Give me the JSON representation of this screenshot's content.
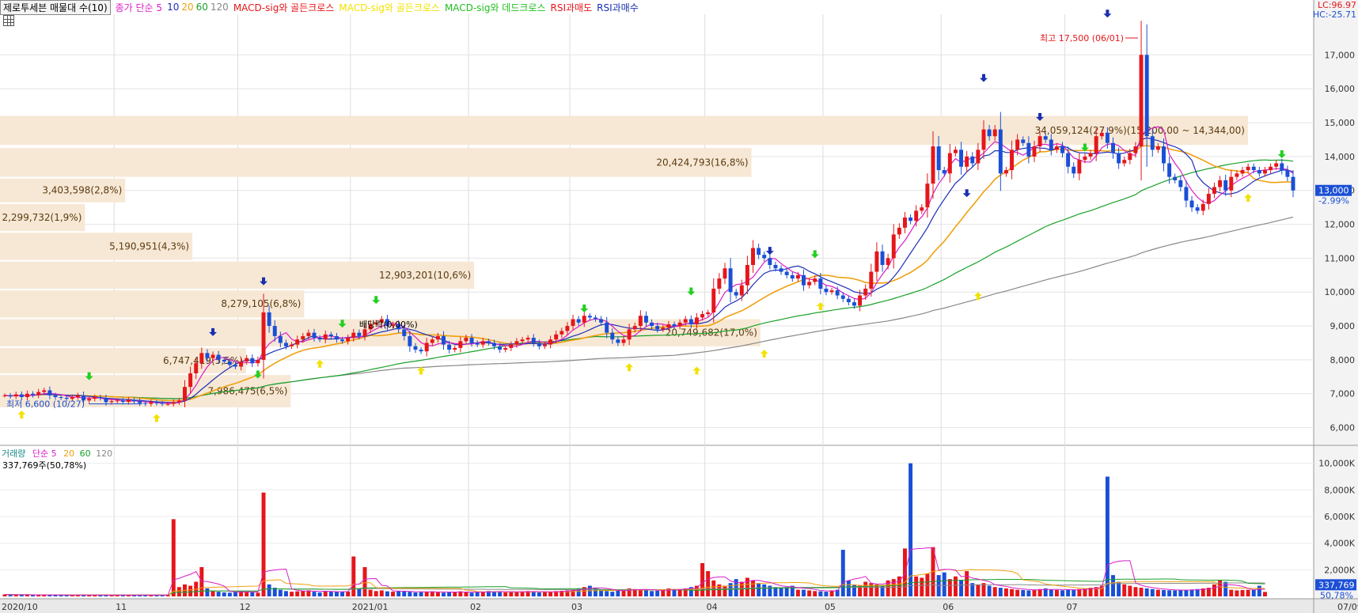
{
  "legend": {
    "title": "제로투세븐 매물대 수(10)",
    "ma_label": "종가 단순 5",
    "ma_periods": [
      "10",
      "20",
      "60",
      "120"
    ],
    "signals": [
      "MACD-sig와 골든크로스",
      "MACD-sig와 골든크로스",
      "MACD-sig와 데드크로스",
      "RSI과매도",
      "RSI과매수"
    ]
  },
  "corner": {
    "lc": "LC:96.97",
    "hc": "HC:-25.71"
  },
  "volume_legend": {
    "label": "거래량",
    "ma_label": "단순 5",
    "periods": [
      "20",
      "60",
      "120"
    ],
    "value_text": "337,769주(50,78%)"
  },
  "colors": {
    "up": "#e5161a",
    "down": "#1a4fd6",
    "ma5": "#d91ec8",
    "ma10": "#1e2fb8",
    "ma20": "#f0a010",
    "ma60": "#1aa02a",
    "ma120": "#888888",
    "profile": "#f7e8d5"
  },
  "chart_data": [
    {
      "type": "candlestick",
      "x_ticks": [
        "2020/10",
        "11",
        "12",
        "2021/01",
        "02",
        "03",
        "04",
        "05",
        "06",
        "07",
        "07/09"
      ],
      "y_ticks": [
        "6,000",
        "7,000",
        "8,000",
        "9,000",
        "10,000",
        "11,000",
        "12,000",
        "13,000",
        "14,000",
        "15,000",
        "16,000",
        "17,000"
      ],
      "ylim": [
        5500,
        18200
      ],
      "last_price": {
        "label": "13,000",
        "change": "-2.99%",
        "value": 13000
      },
      "closes": [
        6950,
        6920,
        6980,
        6900,
        7000,
        6960,
        7050,
        7100,
        6950,
        6900,
        6880,
        6850,
        6900,
        6950,
        6800,
        6850,
        6900,
        6870,
        6750,
        6780,
        6800,
        6760,
        6820,
        6780,
        6720,
        6700,
        6750,
        6720,
        6700,
        6700,
        6750,
        6800,
        7200,
        7600,
        7900,
        8200,
        8050,
        8150,
        8000,
        7950,
        7850,
        7800,
        7950,
        8050,
        7900,
        8000,
        9400,
        9000,
        8700,
        8500,
        8400,
        8450,
        8600,
        8700,
        8800,
        8650,
        8600,
        8750,
        8700,
        8600,
        8550,
        8650,
        8800,
        8700,
        8900,
        9050,
        9100,
        9200,
        9000,
        9050,
        8900,
        8700,
        8400,
        8300,
        8250,
        8500,
        8600,
        8700,
        8450,
        8300,
        8350,
        8550,
        8650,
        8500,
        8450,
        8550,
        8500,
        8400,
        8300,
        8350,
        8450,
        8550,
        8600,
        8650,
        8500,
        8400,
        8450,
        8600,
        8750,
        8850,
        9000,
        9200,
        9100,
        9300,
        9250,
        9200,
        9100,
        8800,
        8600,
        8500,
        8600,
        8900,
        9000,
        9300,
        9100,
        9000,
        8900,
        8950,
        9050,
        9000,
        9100,
        9200,
        9050,
        9250,
        9350,
        9400,
        10100,
        10400,
        10700,
        10000,
        9900,
        10200,
        10800,
        11300,
        11100,
        11000,
        10800,
        10700,
        10600,
        10500,
        10400,
        10500,
        10200,
        10300,
        10400,
        10100,
        10000,
        10050,
        9900,
        9800,
        9700,
        9600,
        9900,
        10100,
        10600,
        11200,
        10800,
        11000,
        11700,
        11900,
        12200,
        12100,
        12400,
        12500,
        13200,
        14300,
        13600,
        13500,
        14100,
        14200,
        13700,
        14000,
        13800,
        14200,
        14800,
        14600,
        14800,
        13500,
        13600,
        14200,
        14500,
        14400,
        14000,
        14300,
        14600,
        14500,
        14200,
        14300,
        14100,
        13700,
        13500,
        13900,
        14000,
        14100,
        14600,
        14700,
        14400,
        14100,
        13800,
        13900,
        14100,
        14300,
        17000,
        14600,
        14200,
        14300,
        13800,
        13400,
        13300,
        13100,
        12700,
        12500,
        12400,
        12600,
        12900,
        13100,
        13300,
        13000,
        13400,
        13500,
        13600,
        13700,
        13600,
        13500,
        13600,
        13700,
        13800,
        13600,
        13400,
        13000
      ],
      "volumes_thousand": [
        150,
        120,
        100,
        140,
        110,
        90,
        130,
        100,
        120,
        110,
        100,
        90,
        110,
        100,
        120,
        100,
        90,
        110,
        100,
        95,
        90,
        100,
        110,
        95,
        90,
        100,
        110,
        95,
        110,
        100,
        5800,
        700,
        900,
        800,
        1100,
        2200,
        600,
        400,
        350,
        300,
        280,
        320,
        400,
        350,
        300,
        280,
        7800,
        900,
        650,
        500,
        400,
        350,
        380,
        420,
        450,
        350,
        300,
        400,
        380,
        350,
        330,
        360,
        3000,
        600,
        2200,
        500,
        400,
        450,
        380,
        350,
        400,
        380,
        350,
        300,
        320,
        360,
        380,
        300,
        280,
        320,
        350,
        380,
        300,
        280,
        320,
        350,
        400,
        380,
        350,
        300,
        320,
        350,
        380,
        400,
        350,
        300,
        320,
        350,
        400,
        420,
        450,
        500,
        600,
        700,
        800,
        600,
        500,
        400,
        350,
        420,
        500,
        600,
        550,
        500,
        450,
        400,
        420,
        500,
        600,
        550,
        500,
        600,
        700,
        800,
        2500,
        1900,
        1200,
        900,
        800,
        1000,
        1300,
        1100,
        1400,
        1200,
        1000,
        900,
        800,
        700,
        600,
        700,
        800,
        500,
        500,
        450,
        400,
        380,
        350,
        450,
        500,
        3500,
        1200,
        900,
        800,
        1100,
        1000,
        900,
        800,
        1200,
        1300,
        1500,
        3600,
        10000,
        1500,
        1400,
        1700,
        3700,
        1600,
        1800,
        1300,
        1500,
        1200,
        1900,
        1000,
        900,
        1000,
        800,
        700,
        650,
        600,
        550,
        500,
        480,
        450,
        500,
        550,
        600,
        520,
        480,
        460,
        500,
        520,
        550,
        600,
        650,
        700,
        800,
        9000,
        1600,
        1100,
        900,
        800,
        700,
        650,
        600,
        550,
        500,
        480,
        460,
        450,
        480,
        500,
        520,
        550,
        600,
        650,
        900,
        1200,
        1100,
        500,
        450,
        480,
        500,
        520,
        800,
        337.769
      ],
      "ma_annotations": [],
      "volume_profile": [
        {
          "label": "34,059,124(27,9%)(15,200,00 ~ 14,344,00)",
          "low": 14344,
          "high": 15200
        },
        {
          "label": "20,424,793(16,8%)",
          "low": 13400,
          "high": 14250
        },
        {
          "label": "3,403,598(2,8%)",
          "low": 12650,
          "high": 13350
        },
        {
          "label": "2,299,732(1,9%)",
          "low": 11800,
          "high": 12600
        },
        {
          "label": "5,190,951(4,3%)",
          "low": 10950,
          "high": 11750
        },
        {
          "label": "12,903,201(10,6%)",
          "low": 10100,
          "high": 10900
        },
        {
          "label": "8,279,105(6,8%)",
          "low": 9250,
          "high": 10050
        },
        {
          "label": "20,749,682(17,0%)",
          "low": 8400,
          "high": 9200
        },
        {
          "label": "6,747,419(5,5%)",
          "low": 7600,
          "high": 8350
        },
        {
          "label": "7,986,475(6,5%)",
          "low": 6600,
          "high": 7550
        }
      ],
      "annotations": {
        "high": "최고 17,500 (06/01)",
        "low": "최저 6,600 (10/27)",
        "dividend": "배당락(0,00%)"
      },
      "volume_y_ticks": [
        "2,000K",
        "4,000K",
        "6,000K",
        "8,000K",
        "10,000K"
      ],
      "volume_last": {
        "label": "337,769",
        "pct": "50,78%"
      }
    }
  ]
}
